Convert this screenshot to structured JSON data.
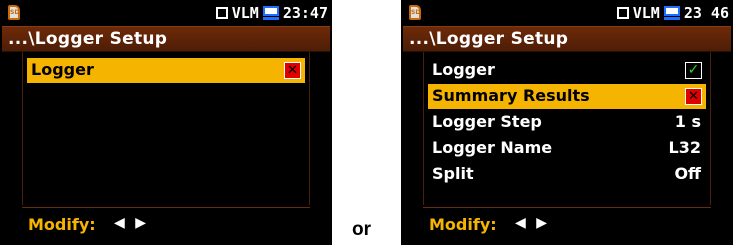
{
  "left_screen": {
    "status": {
      "sd_label": "SD",
      "mode": "VLM",
      "time": "23:47"
    },
    "title": "...\\Logger Setup",
    "rows": [
      {
        "label": "Logger",
        "checkbox": "unchecked",
        "selected": true
      }
    ],
    "footer": {
      "label": "Modify:",
      "arrows": "◀ ▶"
    }
  },
  "right_screen": {
    "status": {
      "sd_label": "SD",
      "mode": "VLM",
      "time": "23 46"
    },
    "title": "...\\Logger Setup",
    "rows": [
      {
        "label": "Logger",
        "checkbox": "checked",
        "selected": false
      },
      {
        "label": "Summary Results",
        "checkbox": "unchecked",
        "selected": true
      },
      {
        "label": "Logger Step",
        "value": "1 s",
        "selected": false
      },
      {
        "label": "Logger Name",
        "value": "L32",
        "selected": false
      },
      {
        "label": "Split",
        "value": "Off",
        "selected": false
      }
    ],
    "footer": {
      "label": "Modify:",
      "arrows": "◀ ▶"
    }
  },
  "separator_text": "or",
  "colors": {
    "highlight": "#f5b400",
    "titlebar": "#6e2a09",
    "checkbox_off": "#e00000",
    "checkbox_on": "#2bd62b",
    "monitor": "#1e6fff"
  }
}
